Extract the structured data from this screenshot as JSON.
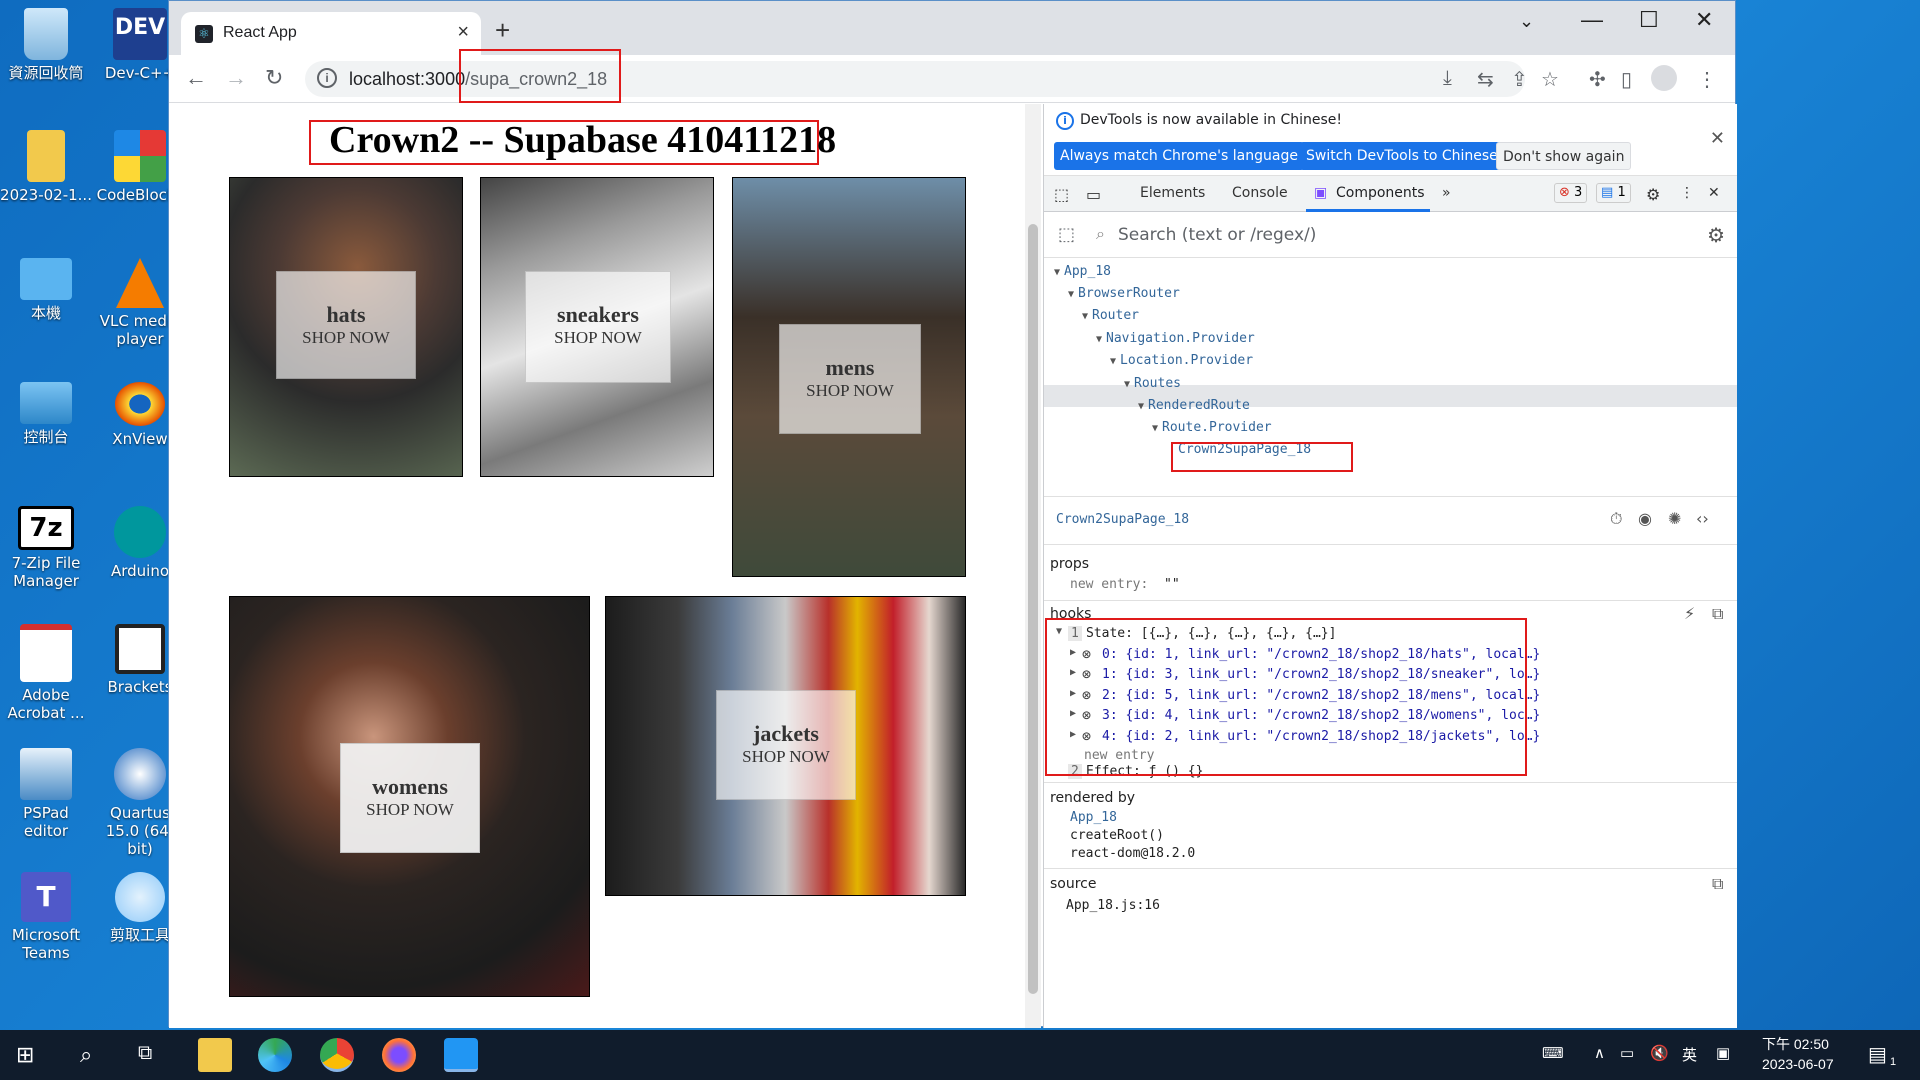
{
  "desktop": {
    "icons": [
      "資源回收筒",
      "Dev-C++",
      "2023-02-1...",
      "CodeBlocks",
      "本機",
      "VLC media player",
      "控制台",
      "XnView",
      "7-Zip File Manager",
      "Arduino",
      "Adobe Acrobat ...",
      "Brackets",
      "PSPad editor",
      "Quartus 15.0 (64-bit)",
      "Microsoft Teams",
      "剪取工具"
    ]
  },
  "browser": {
    "tab_title": "React App",
    "new_tab": "+",
    "url_host": "localhost:3000",
    "url_path": "/supa_crown2_18"
  },
  "page": {
    "title": "Crown2 -- Supabase 410411218",
    "shop_label": "SHOP NOW",
    "categories": [
      {
        "name": "hats"
      },
      {
        "name": "sneakers"
      },
      {
        "name": "mens"
      },
      {
        "name": "womens"
      },
      {
        "name": "jackets"
      }
    ]
  },
  "devtools": {
    "banner_msg": "DevTools is now available in Chinese!",
    "btn_match": "Always match Chrome's language",
    "btn_switch": "Switch DevTools to Chinese",
    "btn_dont": "Don't show again",
    "tabs": [
      "Elements",
      "Console",
      "Components"
    ],
    "error_count": "3",
    "msg_count": "1",
    "search_placeholder": "Search (text or /regex/)",
    "tree": [
      "App_18",
      "BrowserRouter",
      "Router",
      "Navigation.Provider",
      "Location.Provider",
      "Routes",
      "RenderedRoute",
      "Route.Provider",
      "Crown2SupaPage_18"
    ],
    "selected_component": "Crown2SupaPage_18",
    "props_label": "props",
    "props_entry_key": "new entry:",
    "props_entry_val": "\"\"",
    "hooks_label": "hooks",
    "hook_state_index": "1",
    "hook_state": "State: [{…}, {…}, {…}, {…}, {…}]",
    "state_items": [
      "0: {id: 1, link_url: \"/crown2_18/shop2_18/hats\", local…}",
      "1: {id: 3, link_url: \"/crown2_18/shop2_18/sneaker\", lo…}",
      "2: {id: 5, link_url: \"/crown2_18/shop2_18/mens\", local…}",
      "3: {id: 4, link_url: \"/crown2_18/shop2_18/womens\", loc…}",
      "4: {id: 2, link_url: \"/crown2_18/shop2_18/jackets\", lo…}"
    ],
    "new_entry": "new entry",
    "hook_effect_index": "2",
    "hook_effect": "Effect: ƒ () {}",
    "rendered_by_label": "rendered by",
    "rendered_by": [
      "App_18",
      "createRoot()",
      "react-dom@18.2.0"
    ],
    "source_label": "source",
    "source": "App_18.js:16"
  },
  "taskbar": {
    "ime": "英",
    "time_ampm": "下午 02:50",
    "date": "2023-06-07",
    "notif_count": "1"
  }
}
